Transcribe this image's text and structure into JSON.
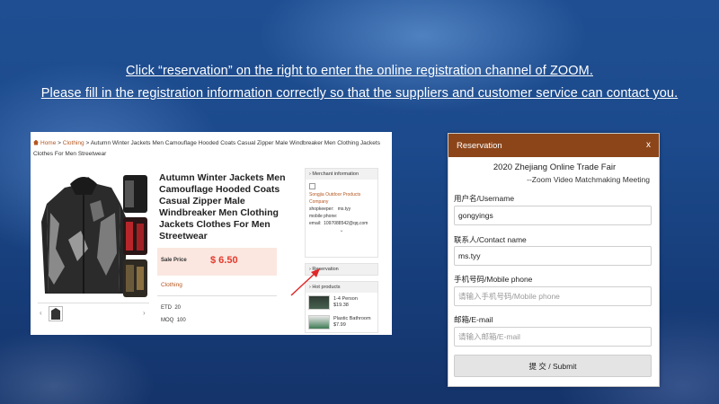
{
  "banner": {
    "line1": "Click “reservation” on the right to enter the online registration channel of ZOOM.",
    "line2": "Please fill in the registration information correctly so that the suppliers and customer service can contact you."
  },
  "product_page": {
    "breadcrumb": {
      "home": "Home",
      "sep": ">",
      "category": "Clothing",
      "current": "Autumn Winter Jackets Men Camouflage Hooded Coats Casual Zipper Male Windbreaker Men Clothing Jackets Clothes For Men Streetwear"
    },
    "title": "Autumn Winter Jackets Men Camouflage Hooded Coats Casual Zipper Male Windbreaker Men Clothing Jackets Clothes For Men Streetwear",
    "price_label": "Sale Price",
    "price": "$ 6.50",
    "category": "Clothing",
    "etd_label": "ETD",
    "etd_value": "20",
    "moq_label": "MOQ",
    "moq_value": "100",
    "thumb_prev": "‹",
    "thumb_next": "›",
    "merchant": {
      "header": "Merchant information",
      "name": "Songjia Outdoor Products Company",
      "shopkeeper_label": "shopkeeper:",
      "shopkeeper": "ms.tyy",
      "mobile_label": "mobile phone:",
      "email_label": "email:",
      "email": "1097088542@qq.com",
      "expand": "⌄"
    },
    "reservation_header": "Reservation",
    "hot": {
      "header": "Hot products",
      "items": [
        {
          "name": "1-4 Person",
          "price": "$19.38"
        },
        {
          "name": "Plastic Bathroom",
          "price": "$7.99"
        }
      ]
    }
  },
  "dialog": {
    "title": "Reservation",
    "close": "x",
    "fair_title": "2020 Zhejiang Online Trade Fair",
    "fair_sub": "--Zoom Video Matchmaking Meeting",
    "username_label": "用户名/Username",
    "username_value": "gongyings",
    "contact_label": "联系人/Contact name",
    "contact_value": "ms.tyy",
    "mobile_label": "手机号码/Mobile phone",
    "mobile_placeholder": "请输入手机号码/Mobile phone",
    "email_label": "邮箱/E-mail",
    "email_placeholder": "请输入邮箱/E-mail",
    "submit": "提 交  / Submit"
  },
  "colors": {
    "dialog_header": "#8c4519",
    "price": "#e53a2d",
    "link": "#b5561f",
    "price_bg": "#fbe7e0",
    "arrow": "#e0282a"
  }
}
